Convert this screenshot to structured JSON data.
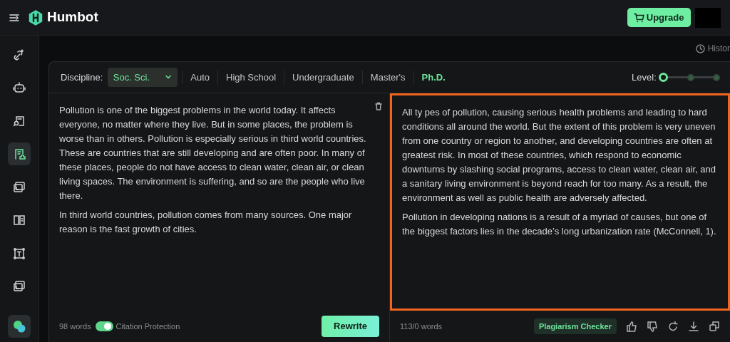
{
  "app": {
    "brand": "Humbot",
    "upgrade": "Upgrade"
  },
  "sidebar": {
    "items": [
      {
        "kind": "magic",
        "selected": false
      },
      {
        "kind": "robot",
        "selected": false
      },
      {
        "kind": "doc-search",
        "selected": false
      },
      {
        "kind": "doc-check",
        "selected": true
      },
      {
        "kind": "cards",
        "selected": false
      },
      {
        "kind": "book",
        "selected": false
      },
      {
        "kind": "text-frame",
        "selected": false
      },
      {
        "kind": "cards",
        "selected": false
      }
    ]
  },
  "history": "Histor",
  "toolbar": {
    "discipline_label": "Discipline:",
    "discipline": "Soc. Sci.",
    "levels": [
      {
        "label": "Auto",
        "selected": false
      },
      {
        "label": "High School",
        "selected": false
      },
      {
        "label": "Undergraduate",
        "selected": false
      },
      {
        "label": "Master's",
        "selected": false
      },
      {
        "label": "Ph.D.",
        "selected": true
      }
    ],
    "level_label": "Level:",
    "level_steps": [
      {
        "selected": true
      },
      {
        "selected": false
      },
      {
        "selected": false
      }
    ]
  },
  "input": {
    "paragraphs": [
      "Pollution is one of the biggest problems in the world today. It affects everyone, no matter where they live. But in some places, the problem is worse than in others. Pollution is especially serious in third world countries. These are countries that are still developing and are often poor. In many of these places, people do not have access to clean water, clean air, or clean living spaces. The environment is suffering, and so are the people who live there.",
      "In third world countries, pollution comes from many sources. One major reason is the fast growth of cities."
    ],
    "word_count": "98 words",
    "citation_protection": {
      "label": "Citation Protection",
      "on": true
    },
    "rewrite": "Rewrite"
  },
  "output": {
    "highlighted": true,
    "paragraphs": [
      "All ty pes of pollution, causing serious health problems and leading to hard conditions all around the world. But the extent of this problem is very uneven from one country or region to another, and developing countries are often at greatest risk. In most of these countries, which respond to economic downturns by slashing social programs, access to clean water, clean air, and a sanitary living environment is beyond reach for too many. As a result, the environment as well as public health are adversely affected.",
      "Pollution in developing nations is a result of a myriad of causes, but one of the biggest factors lies in the decade’s long urbanization rate (McConnell, 1)."
    ],
    "word_count": "113/0 words",
    "plagiarism": "Plagiarism Checker"
  }
}
